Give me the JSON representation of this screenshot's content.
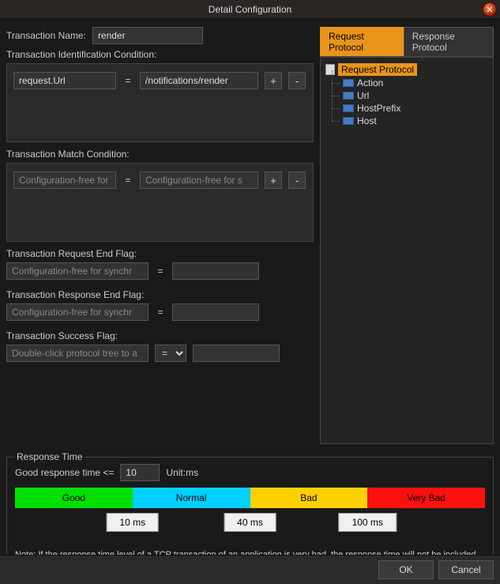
{
  "window": {
    "title": "Detail Configuration"
  },
  "transaction_name": {
    "label": "Transaction Name:",
    "value": "render"
  },
  "identification": {
    "label": "Transaction Identification Condition:",
    "left_value": "request.Url",
    "right_value": "/notifications/render"
  },
  "match": {
    "label": "Transaction Match Condition:",
    "left_placeholder": "Configuration-free for s",
    "right_placeholder": "Configuration-free for s"
  },
  "request_end": {
    "label": "Transaction Request End Flag:",
    "placeholder": "Configuration-free for synchr"
  },
  "response_end": {
    "label": "Transaction Response End Flag:",
    "placeholder": "Configuration-free for synchr"
  },
  "success": {
    "label": "Transaction Success Flag:",
    "placeholder": "Double-click protocol tree to a",
    "op": "="
  },
  "response_time": {
    "legend": "Response Time",
    "good_label": "Good response time <=",
    "good_value": "10",
    "unit": "Unit:ms",
    "segments": [
      "Good",
      "Normal",
      "Bad",
      "Very Bad"
    ],
    "thresholds": [
      "10 ms",
      "40 ms",
      "100 ms"
    ],
    "note": "Note: If the response time level of a TCP transaction of an application is very bad, the response time will not be included when figuring average response time of the application."
  },
  "tabs": {
    "request": "Request Protocol",
    "response": "Response Protocol"
  },
  "tree": {
    "root": "Request Protocol",
    "children": [
      "Action",
      "Url",
      "HostPrefix",
      "Host"
    ]
  },
  "buttons": {
    "ok": "OK",
    "cancel": "Cancel",
    "add": "+",
    "remove": "-"
  }
}
